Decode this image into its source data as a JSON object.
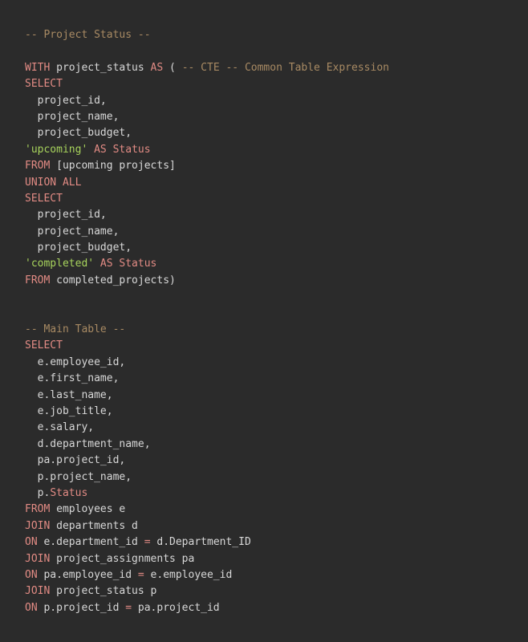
{
  "code": {
    "lines": [
      [
        {
          "t": "-- Project Status --",
          "c": "cm"
        }
      ],
      [],
      [
        {
          "t": "WITH ",
          "c": "kw"
        },
        {
          "t": "project_status ",
          "c": "id"
        },
        {
          "t": "AS",
          "c": "kw"
        },
        {
          "t": " ( ",
          "c": "pu"
        },
        {
          "t": "-- CTE -- Common Table Expression",
          "c": "cm"
        }
      ],
      [
        {
          "t": "SELECT",
          "c": "kw"
        }
      ],
      [
        {
          "t": "  project_id,",
          "c": "id"
        }
      ],
      [
        {
          "t": "  project_name,",
          "c": "id"
        }
      ],
      [
        {
          "t": "  project_budget,",
          "c": "id"
        }
      ],
      [
        {
          "t": "'upcoming'",
          "c": "str"
        },
        {
          "t": " AS ",
          "c": "kw"
        },
        {
          "t": "Status",
          "c": "kw"
        }
      ],
      [
        {
          "t": "FROM ",
          "c": "kw"
        },
        {
          "t": "[upcoming projects]",
          "c": "id"
        }
      ],
      [
        {
          "t": "UNION ALL",
          "c": "kw"
        }
      ],
      [
        {
          "t": "SELECT",
          "c": "kw"
        }
      ],
      [
        {
          "t": "  project_id,",
          "c": "id"
        }
      ],
      [
        {
          "t": "  project_name,",
          "c": "id"
        }
      ],
      [
        {
          "t": "  project_budget,",
          "c": "id"
        }
      ],
      [
        {
          "t": "'completed'",
          "c": "str"
        },
        {
          "t": " AS ",
          "c": "kw"
        },
        {
          "t": "Status",
          "c": "kw"
        }
      ],
      [
        {
          "t": "FROM ",
          "c": "kw"
        },
        {
          "t": "completed_projects)",
          "c": "id"
        }
      ],
      [],
      [],
      [
        {
          "t": "-- Main Table --",
          "c": "cm"
        }
      ],
      [
        {
          "t": "SELECT",
          "c": "kw"
        }
      ],
      [
        {
          "t": "  e.employee_id,",
          "c": "id"
        }
      ],
      [
        {
          "t": "  e.first_name,",
          "c": "id"
        }
      ],
      [
        {
          "t": "  e.last_name,",
          "c": "id"
        }
      ],
      [
        {
          "t": "  e.job_title,",
          "c": "id"
        }
      ],
      [
        {
          "t": "  e.salary,",
          "c": "id"
        }
      ],
      [
        {
          "t": "  d.department_name,",
          "c": "id"
        }
      ],
      [
        {
          "t": "  pa.project_id,",
          "c": "id"
        }
      ],
      [
        {
          "t": "  p.project_name,",
          "c": "id"
        }
      ],
      [
        {
          "t": "  p.",
          "c": "id"
        },
        {
          "t": "Status",
          "c": "kw"
        }
      ],
      [
        {
          "t": "FROM ",
          "c": "kw"
        },
        {
          "t": "employees e",
          "c": "id"
        }
      ],
      [
        {
          "t": "JOIN ",
          "c": "kw"
        },
        {
          "t": "departments d",
          "c": "id"
        }
      ],
      [
        {
          "t": "ON ",
          "c": "kw"
        },
        {
          "t": "e.department_id ",
          "c": "id"
        },
        {
          "t": "=",
          "c": "op"
        },
        {
          "t": " d.Department_ID",
          "c": "id"
        }
      ],
      [
        {
          "t": "JOIN ",
          "c": "kw"
        },
        {
          "t": "project_assignments pa",
          "c": "id"
        }
      ],
      [
        {
          "t": "ON ",
          "c": "kw"
        },
        {
          "t": "pa.employee_id ",
          "c": "id"
        },
        {
          "t": "=",
          "c": "op"
        },
        {
          "t": " e.employee_id",
          "c": "id"
        }
      ],
      [
        {
          "t": "JOIN ",
          "c": "kw"
        },
        {
          "t": "project_status p",
          "c": "id"
        }
      ],
      [
        {
          "t": "ON ",
          "c": "kw"
        },
        {
          "t": "p.project_id ",
          "c": "id"
        },
        {
          "t": "=",
          "c": "op"
        },
        {
          "t": " pa.project_id",
          "c": "id"
        }
      ]
    ]
  }
}
